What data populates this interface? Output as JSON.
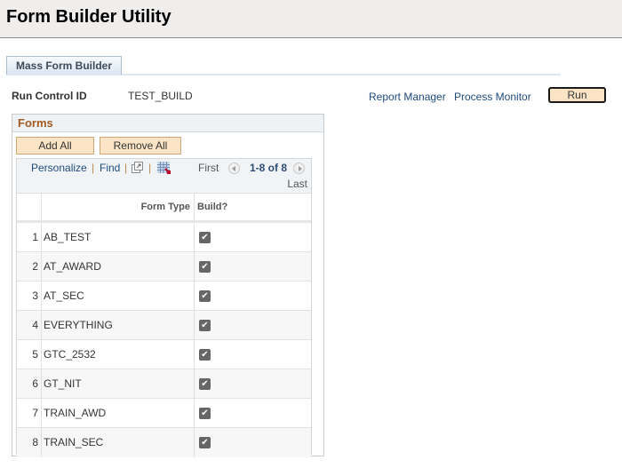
{
  "header": {
    "title": "Form Builder Utility"
  },
  "tabs": [
    {
      "label": "Mass Form Builder"
    }
  ],
  "run_control": {
    "label": "Run Control ID",
    "value": "TEST_BUILD"
  },
  "links": {
    "report_manager": "Report Manager",
    "process_monitor": "Process Monitor"
  },
  "run_button": "Run",
  "forms": {
    "title": "Forms",
    "add_all": "Add All",
    "remove_all": "Remove All",
    "nav": {
      "personalize": "Personalize",
      "find": "Find",
      "separator": "|",
      "first": "First",
      "count": "1-8 of 8",
      "last": "Last"
    },
    "columns": {
      "form_type": "Form Type",
      "build": "Build?"
    },
    "rows": [
      {
        "num": "1",
        "form_type": "AB_TEST",
        "build": true
      },
      {
        "num": "2",
        "form_type": "AT_AWARD",
        "build": true
      },
      {
        "num": "3",
        "form_type": "AT_SEC",
        "build": true
      },
      {
        "num": "4",
        "form_type": "EVERYTHING",
        "build": true
      },
      {
        "num": "5",
        "form_type": "GTC_2532",
        "build": true
      },
      {
        "num": "6",
        "form_type": "GT_NIT",
        "build": true
      },
      {
        "num": "7",
        "form_type": "TRAIN_AWD",
        "build": true
      },
      {
        "num": "8",
        "form_type": "TRAIN_SEC",
        "build": true
      }
    ],
    "checkmark_glyph": "✔"
  }
}
